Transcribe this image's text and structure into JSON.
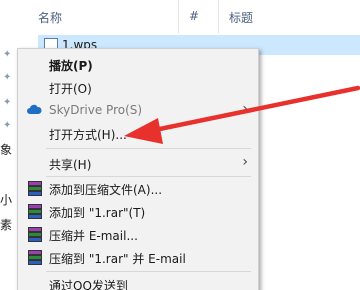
{
  "columns": {
    "name": "名称",
    "number": "#",
    "title": "标题"
  },
  "file": {
    "name": "1.wps"
  },
  "nav": {
    "chars": [
      "象",
      "小",
      "素"
    ]
  },
  "menu": {
    "items": [
      {
        "label": "播放(P)",
        "bold": true
      },
      {
        "label": "打开(O)"
      },
      {
        "label": "SkyDrive Pro(S)",
        "disabled": true,
        "submenu": true,
        "icon": "cloud-icon"
      },
      {
        "label": "打开方式(H)..."
      },
      {
        "label": "共享(H)",
        "submenu": true
      },
      {
        "label": "添加到压缩文件(A)...",
        "icon": "winrar-icon"
      },
      {
        "label": "添加到 \"1.rar\"(T)",
        "icon": "winrar-icon"
      },
      {
        "label": "压缩并 E-mail...",
        "icon": "winrar-icon"
      },
      {
        "label": "压缩到 \"1.rar\" 并 E-mail",
        "icon": "winrar-icon"
      },
      {
        "label": "通过QQ发送到"
      }
    ]
  },
  "colors": {
    "selection": "#cce8ff",
    "menu_bg": "#f2f2f2",
    "arrow": "#e8302c",
    "header_text": "#4d6082"
  }
}
